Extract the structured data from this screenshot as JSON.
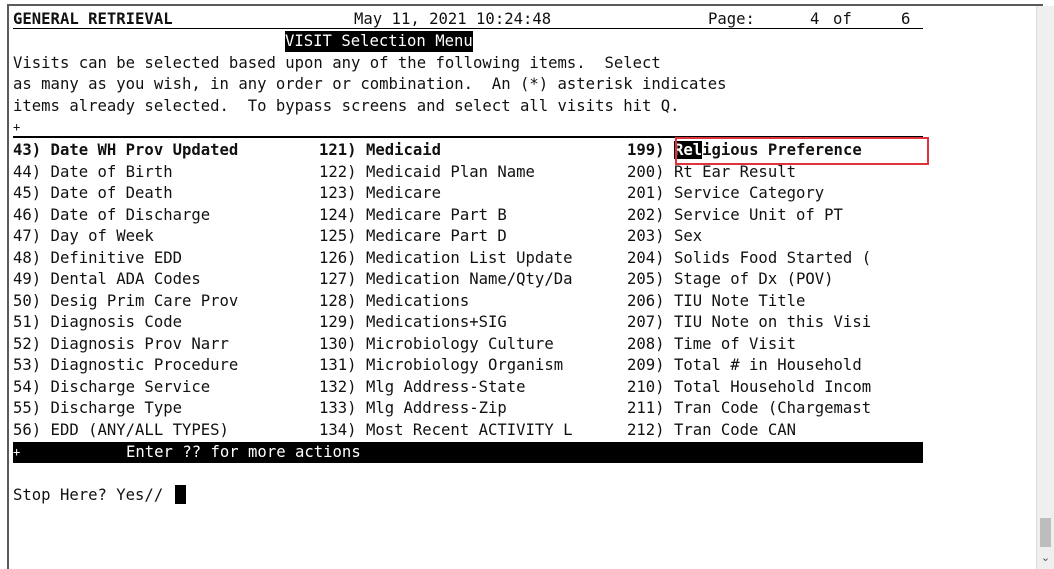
{
  "header": {
    "app": "GENERAL RETRIEVAL",
    "datetime": "May 11, 2021 10:24:48",
    "page_label": "Page:",
    "page_current": "4",
    "page_of": "of",
    "page_total": "6"
  },
  "menu_title": "VISIT Selection Menu",
  "intro": [
    "Visits can be selected based upon any of the following items.  Select",
    "as many as you wish, in any order or combination.  An (*) asterisk indicates",
    "items already selected.  To bypass screens and select all visits hit Q."
  ],
  "top_marker": "+",
  "columns": {
    "col1": [
      "43) Date WH Prov Updated",
      "44) Date of Birth",
      "45) Date of Death",
      "46) Date of Discharge",
      "47) Day of Week",
      "48) Definitive EDD",
      "49) Dental ADA Codes",
      "50) Desig Prim Care Prov",
      "51) Diagnosis Code",
      "52) Diagnosis Prov Narr",
      "53) Diagnostic Procedure",
      "54) Discharge Service",
      "55) Discharge Type",
      "56) EDD (ANY/ALL TYPES)"
    ],
    "col2": [
      "121) Medicaid",
      "122) Medicaid Plan Name",
      "123) Medicare",
      "124) Medicare Part B",
      "125) Medicare Part D",
      "126) Medication List Update",
      "127) Medication Name/Qty/Da",
      "128) Medications",
      "129) Medications+SIG",
      "130) Microbiology Culture",
      "131) Microbiology Organism",
      "132) Mlg Address-State",
      "133) Mlg Address-Zip",
      "134) Most Recent ACTIVITY L"
    ],
    "col3": [
      "199) Religious Preference",
      "200) Rt Ear Result",
      "201) Service Category",
      "202) Service Unit of PT",
      "203) Sex",
      "204) Solids Food Started (",
      "205) Stage of Dx (POV)",
      "206) TIU Note Title",
      "207) TIU Note on this Visi",
      "208) Time of Visit",
      "209) Total # in Household",
      "210) Total Household Incom",
      "211) Tran Code (Chargemast",
      "212) Tran Code CAN"
    ]
  },
  "selected_row_prefix": "199) ",
  "selected_row_cursor": "Rel",
  "selected_row_rest": "igious Preference",
  "action_bar": {
    "marker": "+",
    "text": "Enter ?? for more actions"
  },
  "prompt": "Stop Here? Yes//"
}
